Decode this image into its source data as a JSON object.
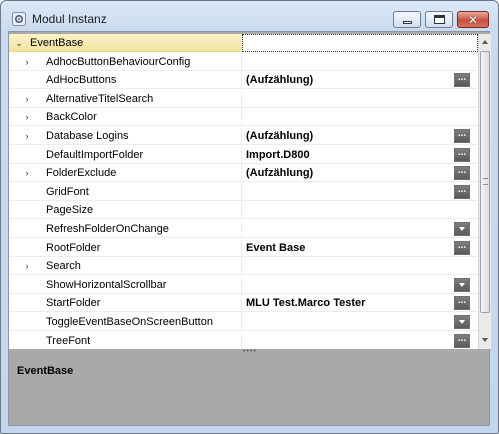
{
  "window": {
    "title": "Modul Instanz",
    "close_glyph": "✕"
  },
  "grid": {
    "rows": [
      {
        "label": "EventBase",
        "value": "",
        "chevron": "⌄",
        "expandable": true,
        "expanded": true,
        "button": "none",
        "selected": true
      },
      {
        "label": "AdhocButtonBehaviourConfig",
        "value": "",
        "chevron": "›",
        "expandable": true,
        "button": "none"
      },
      {
        "label": "AdHocButtons",
        "value": "(Aufzählung)",
        "chevron": "",
        "expandable": false,
        "button": "ellipsis"
      },
      {
        "label": "AlternativeTitelSearch",
        "value": "",
        "chevron": "›",
        "expandable": true,
        "button": "none"
      },
      {
        "label": "BackColor",
        "value": "",
        "chevron": "›",
        "expandable": true,
        "button": "none"
      },
      {
        "label": "Database Logins",
        "value": "(Aufzählung)",
        "chevron": "›",
        "expandable": true,
        "button": "ellipsis"
      },
      {
        "label": "DefaultImportFolder",
        "value": "Import.D800",
        "chevron": "",
        "expandable": false,
        "button": "ellipsis"
      },
      {
        "label": "FolderExclude",
        "value": "(Aufzählung)",
        "chevron": "›",
        "expandable": true,
        "button": "ellipsis"
      },
      {
        "label": "GridFont",
        "value": "",
        "chevron": "",
        "expandable": false,
        "button": "ellipsis"
      },
      {
        "label": "PageSize",
        "value": "",
        "chevron": "",
        "expandable": false,
        "button": "none"
      },
      {
        "label": "RefreshFolderOnChange",
        "value": "",
        "chevron": "",
        "expandable": false,
        "button": "dropdown"
      },
      {
        "label": "RootFolder",
        "value": "Event Base",
        "chevron": "",
        "expandable": false,
        "button": "ellipsis"
      },
      {
        "label": "Search",
        "value": "",
        "chevron": "›",
        "expandable": true,
        "button": "none"
      },
      {
        "label": "ShowHorizontalScrollbar",
        "value": "",
        "chevron": "",
        "expandable": false,
        "button": "dropdown"
      },
      {
        "label": "StartFolder",
        "value": "MLU Test.Marco Tester",
        "chevron": "",
        "expandable": false,
        "button": "ellipsis"
      },
      {
        "label": "ToggleEventBaseOnScreenButton",
        "value": "",
        "chevron": "",
        "expandable": false,
        "button": "dropdown"
      },
      {
        "label": "TreeFont",
        "value": "",
        "chevron": "",
        "expandable": false,
        "button": "ellipsis"
      }
    ],
    "ellipsis_label": "...",
    "dropdown_icon": "chevron-down-icon",
    "scrollbar": {
      "position": 0.0
    }
  },
  "splitter": {
    "grip": "••••"
  },
  "description": {
    "title": "EventBase",
    "text": ""
  },
  "colors": {
    "window_frame": "#c3d6ec",
    "selected_row": "#f2e3a2",
    "panel_bg": "#a9a9a9",
    "close_button": "#c8503e"
  }
}
